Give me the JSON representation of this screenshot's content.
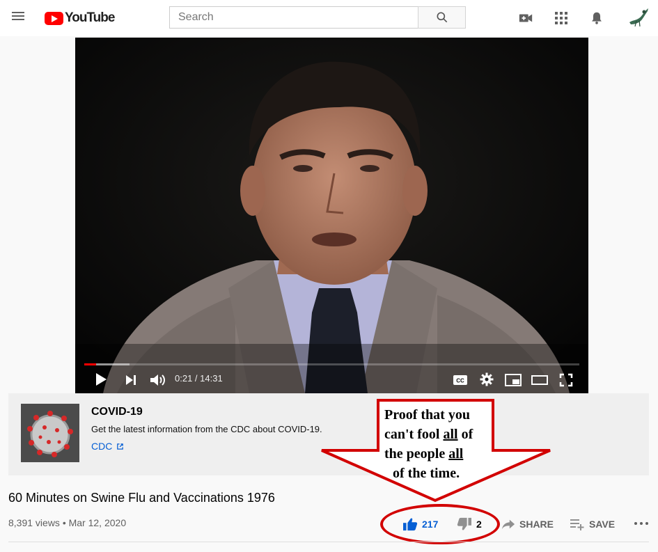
{
  "header": {
    "logo_text": "YouTube",
    "search_placeholder": "Search"
  },
  "player": {
    "time_label": "0:21 / 14:31",
    "progress_fraction": 0.024,
    "buffered_fraction": 0.092
  },
  "covid_panel": {
    "title": "COVID-19",
    "description": "Get the latest information from the CDC about COVID-19.",
    "link_text": "CDC"
  },
  "annotation": {
    "line1": "Proof that you",
    "line2_a": "can't fool ",
    "line2_u": "all",
    "line2_b": " of",
    "line3_a": "the people ",
    "line3_u": "all",
    "line4": "of the time.",
    "color": "#d20000"
  },
  "video": {
    "title": "60 Minutes on Swine Flu and Vaccinations 1976",
    "meta": "8,391 views • Mar 12, 2020",
    "likes": "217",
    "dislikes": "2",
    "share_label": "SHARE",
    "save_label": "SAVE"
  },
  "colors": {
    "brand_red": "#ff0000",
    "link_blue": "#065fd4"
  }
}
